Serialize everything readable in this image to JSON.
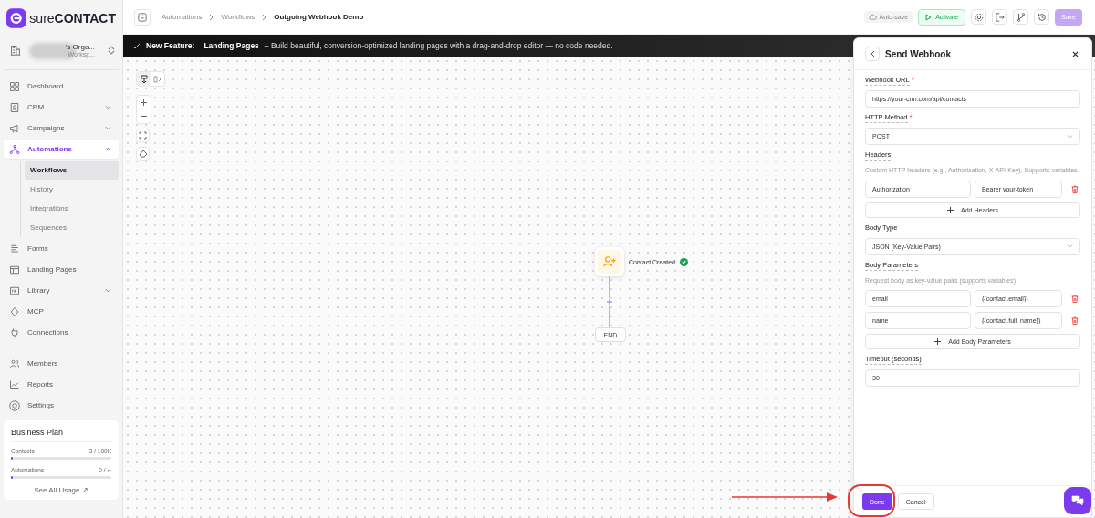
{
  "logo": {
    "light": "sure",
    "bold": "CONTACT"
  },
  "org": {
    "name": "’s Orga...",
    "workspace": "Worksp..."
  },
  "nav_groups": [
    [
      {
        "label": "Dashboard",
        "selected": false
      },
      {
        "label": "CRM",
        "expanded": false,
        "selected": false
      },
      {
        "label": "Campaigns",
        "expanded": false,
        "selected": false
      },
      {
        "label": "Automations",
        "expanded": true,
        "selected": true,
        "children": [
          {
            "label": "Workflows",
            "selected": true
          },
          {
            "label": "History",
            "selected": false
          },
          {
            "label": "Integrations",
            "selected": false
          },
          {
            "label": "Sequences",
            "selected": false
          }
        ]
      },
      {
        "label": "Forms",
        "selected": false
      },
      {
        "label": "Landing Pages",
        "selected": false
      },
      {
        "label": "Library",
        "expanded": false,
        "selected": false
      },
      {
        "label": "MCP",
        "selected": false
      },
      {
        "label": "Connections",
        "selected": false
      }
    ],
    [
      {
        "label": "Members",
        "selected": false
      },
      {
        "label": "Reports",
        "selected": false
      },
      {
        "label": "Settings",
        "selected": false
      }
    ]
  ],
  "plan": {
    "title": "Business Plan",
    "usage": [
      {
        "label": "Contacts",
        "value": "3 / 100K",
        "level": 0.0
      },
      {
        "label": "Automations",
        "value": "0 / ∞",
        "level": 0.0
      }
    ],
    "link": "See All Usage ↗"
  },
  "breadcrumb": [
    {
      "label": "Automations",
      "current": false
    },
    {
      "label": "Workflows",
      "current": false
    },
    {
      "label": "Outgoing Webhook Demo",
      "current": true
    }
  ],
  "toolbar": {
    "autosave": "Auto-save",
    "activate": "Activate",
    "save": "Save",
    "save_disabled": true
  },
  "banner": {
    "label": "New Feature:",
    "title": "Landing Pages",
    "text": "– Build beautiful, conversion-optimized landing pages with a drag-and-drop editor — no code needed."
  },
  "canvas": {
    "layout_options": [
      {
        "selected": true
      },
      {
        "selected": false
      }
    ],
    "trigger": {
      "label": "Contact Created",
      "done": true
    },
    "end": "END"
  },
  "panel": {
    "title": "Send Webhook",
    "fields": [
      {
        "kind": "input",
        "label": "Webhook URL",
        "required_mark": "*",
        "value": "https://your-crm.com/api/contacts"
      },
      {
        "kind": "select",
        "label": "HTTP Method",
        "required_mark": "*",
        "value": "POST"
      },
      {
        "kind": "pairs",
        "label": "Headers",
        "help": "Custom HTTP headers (e.g., Authorization, X-API-Key). Supports variables.",
        "rows": [
          {
            "key": "Authorization",
            "value": "Bearer your-token"
          }
        ],
        "add": "Add Headers"
      },
      {
        "kind": "select",
        "label": "Body Type",
        "value": "JSON (Key-Value Pairs)"
      },
      {
        "kind": "pairs",
        "label": "Body Parameters",
        "help": "Request body as key-value pairs (supports variables)",
        "rows": [
          {
            "key": "email",
            "value": "{{contact.email}}"
          },
          {
            "key": "name",
            "value": "{{contact.full_name}}"
          }
        ],
        "add": "Add Body Parameters"
      },
      {
        "kind": "input",
        "label": "Timeout (seconds)",
        "value": "30"
      }
    ],
    "done": "Done",
    "cancel": "Cancel"
  }
}
